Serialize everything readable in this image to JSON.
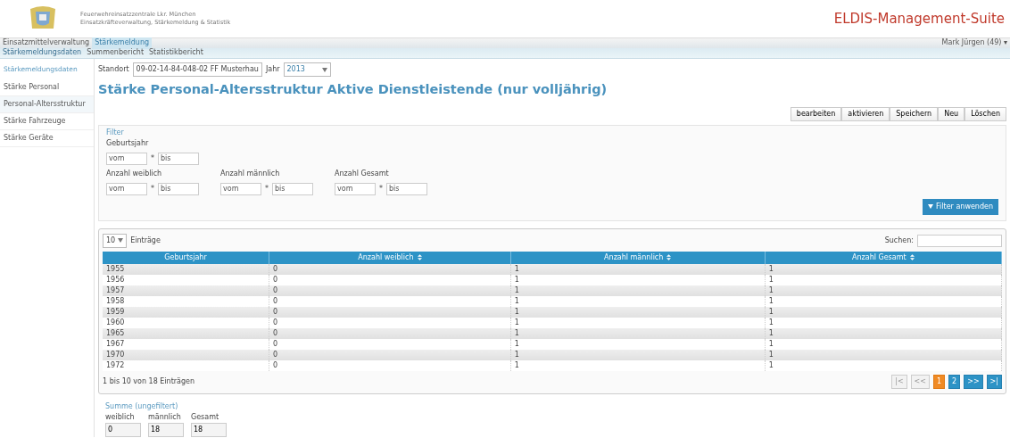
{
  "header": {
    "org_line": "Feuerwehreinsatzzentrale Lkr. München",
    "subtitle": "Einsatzkräfteverwaltung, Stärkemeldung & Statistik",
    "app_title": "ELDIS-Management-Suite"
  },
  "main_nav": [
    {
      "label": "Einsatzmittelverwaltung",
      "selected": false
    },
    {
      "label": "Stärkemeldung",
      "selected": true
    }
  ],
  "user": "Mark Jürgen (49) ▾",
  "sub_nav": [
    {
      "label": "Stärkemeldungsdaten",
      "selected": true
    },
    {
      "label": "Summenbericht",
      "selected": false
    },
    {
      "label": "Statistikbericht",
      "selected": false
    }
  ],
  "sidebar": {
    "title": "Stärkemeldungsdaten",
    "items": [
      {
        "label": "Stärke Personal",
        "selected": false
      },
      {
        "label": "Personal-Altersstruktur",
        "selected": true
      },
      {
        "label": "Stärke Fahrzeuge",
        "selected": false
      },
      {
        "label": "Stärke Geräte",
        "selected": false
      }
    ]
  },
  "context": {
    "standort_label": "Standort",
    "standort_value": "09-02-14-84-048-02 FF Musterhau",
    "jahr_label": "Jahr",
    "jahr_value": "2013"
  },
  "page_title": "Stärke Personal-Altersstruktur Aktive Dienstleistende (nur volljährig)",
  "toolbar": [
    "bearbeiten",
    "aktivieren",
    "Speichern",
    "Neu",
    "Löschen"
  ],
  "filter": {
    "legend": "Filter",
    "groups": [
      {
        "label": "Geburtsjahr",
        "from": "vom",
        "separator": "*",
        "to": "bis"
      },
      {
        "label": "Anzahl weiblich",
        "from": "vom",
        "separator": "*",
        "to": "bis"
      },
      {
        "label": "Anzahl männlich",
        "from": "vom",
        "separator": "*",
        "to": "bis"
      },
      {
        "label": "Anzahl Gesamt",
        "from": "vom",
        "separator": "*",
        "to": "bis"
      }
    ],
    "apply": "Filter anwenden"
  },
  "table": {
    "page_size": "10",
    "page_size_label": "Einträge",
    "search_label": "Suchen:",
    "columns": [
      "Geburtsjahr",
      "Anzahl weiblich",
      "Anzahl männlich",
      "Anzahl Gesamt"
    ],
    "rows": [
      [
        "1955",
        "0",
        "1",
        "1"
      ],
      [
        "1956",
        "0",
        "1",
        "1"
      ],
      [
        "1957",
        "0",
        "1",
        "1"
      ],
      [
        "1958",
        "0",
        "1",
        "1"
      ],
      [
        "1959",
        "0",
        "1",
        "1"
      ],
      [
        "1960",
        "0",
        "1",
        "1"
      ],
      [
        "1965",
        "0",
        "1",
        "1"
      ],
      [
        "1967",
        "0",
        "1",
        "1"
      ],
      [
        "1970",
        "0",
        "1",
        "1"
      ],
      [
        "1972",
        "0",
        "1",
        "1"
      ]
    ],
    "info": "1 bis 10 von 18 Einträgen",
    "pager": [
      {
        "label": "|<",
        "kind": "disabled",
        "selected": false
      },
      {
        "label": "<<",
        "kind": "disabled",
        "selected": false
      },
      {
        "label": "1",
        "kind": "page",
        "selected": true
      },
      {
        "label": "2",
        "kind": "page",
        "selected": false
      },
      {
        "label": ">>",
        "kind": "nav",
        "selected": false
      },
      {
        "label": ">|",
        "kind": "nav",
        "selected": false
      }
    ]
  },
  "sum": {
    "legend": "Summe (ungefiltert)",
    "fields": [
      {
        "label": "weiblich",
        "value": "0"
      },
      {
        "label": "männlich",
        "value": "18"
      },
      {
        "label": "Gesamt",
        "value": "18"
      }
    ]
  }
}
